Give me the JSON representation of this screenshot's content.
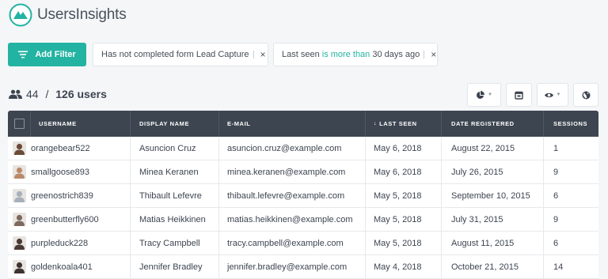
{
  "app": {
    "logo_text": "UsersInsights"
  },
  "toolbar": {
    "add_filter_label": "Add Filter",
    "filters": [
      {
        "prefix": "Has not completed form Lead Capture",
        "highlight": "",
        "suffix": ""
      },
      {
        "prefix": "Last seen ",
        "highlight": "is more than",
        "suffix": " 30 days ago"
      }
    ],
    "remove_symbol": "×"
  },
  "summary": {
    "shown": "44",
    "separator": " / ",
    "total": "126 users"
  },
  "tools": [
    {
      "name": "segments-pie-icon"
    },
    {
      "name": "export-calendar-icon"
    },
    {
      "name": "columns-eye-icon"
    },
    {
      "name": "map-globe-icon"
    }
  ],
  "table": {
    "columns": [
      "USERNAME",
      "DISPLAY NAME",
      "E-MAIL",
      "LAST SEEN",
      "DATE REGISTERED",
      "SESSIONS"
    ],
    "sort_indicator": "↓",
    "rows": [
      {
        "username": "orangebear522",
        "display_name": "Asuncion Cruz",
        "email": "asuncion.cruz@example.com",
        "last_seen": "May 6, 2018",
        "registered": "August 22, 2015",
        "sessions": "1",
        "avatar_color": "#6b4a3a"
      },
      {
        "username": "smallgoose893",
        "display_name": "Minea Keranen",
        "email": "minea.keranen@example.com",
        "last_seen": "May 6, 2018",
        "registered": "July 26, 2015",
        "sessions": "9",
        "avatar_color": "#b98a6a"
      },
      {
        "username": "greenostrich839",
        "display_name": "Thibault Lefevre",
        "email": "thibault.lefevre@example.com",
        "last_seen": "May 5, 2018",
        "registered": "September 10, 2015",
        "sessions": "6",
        "avatar_color": "#a7b0ba"
      },
      {
        "username": "greenbutterfly600",
        "display_name": "Matias Heikkinen",
        "email": "matias.heikkinen@example.com",
        "last_seen": "May 5, 2018",
        "registered": "July 31, 2015",
        "sessions": "9",
        "avatar_color": "#7d6a5c"
      },
      {
        "username": "purpleduck228",
        "display_name": "Tracy Campbell",
        "email": "tracy.campbell@example.com",
        "last_seen": "May 5, 2018",
        "registered": "August 11, 2015",
        "sessions": "6",
        "avatar_color": "#4a3a36"
      },
      {
        "username": "goldenkoala401",
        "display_name": "Jennifer Bradley",
        "email": "jennifer.bradley@example.com",
        "last_seen": "May 4, 2018",
        "registered": "October 21, 2015",
        "sessions": "14",
        "avatar_color": "#3e3330"
      }
    ]
  },
  "colors": {
    "accent": "#23b3a2",
    "header": "#3d4650"
  }
}
